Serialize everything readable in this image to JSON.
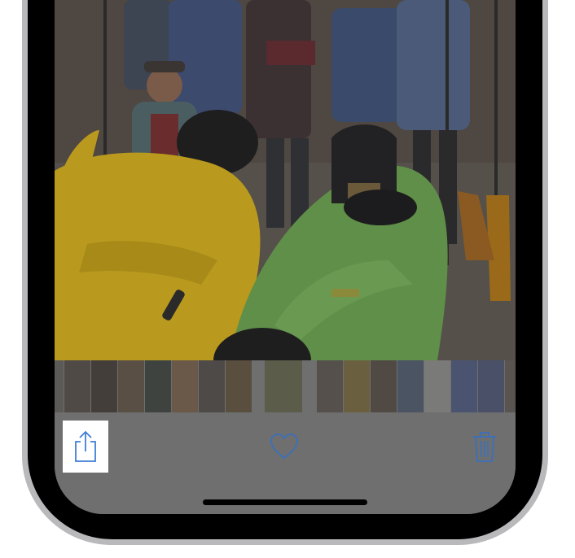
{
  "toolbar": {
    "items": [
      {
        "name": "share",
        "icon": "share-icon",
        "highlighted": true
      },
      {
        "name": "like",
        "icon": "heart-icon",
        "highlighted": false
      },
      {
        "name": "delete",
        "icon": "trash-icon",
        "highlighted": false
      }
    ],
    "icon_color": "#3f7fd4",
    "highlight_color": "#ffffff"
  },
  "photo": {
    "subject": "group-with-kayaks-photo"
  },
  "thumbnails": {
    "count": 17,
    "selected_index": 8
  },
  "colors": {
    "dim_gray": "#6f6f6f",
    "bezel": "#000000",
    "rim": "#b9b9bc",
    "yellow_kayak": "#b99a1e",
    "green_kayak": "#5f8f48"
  }
}
